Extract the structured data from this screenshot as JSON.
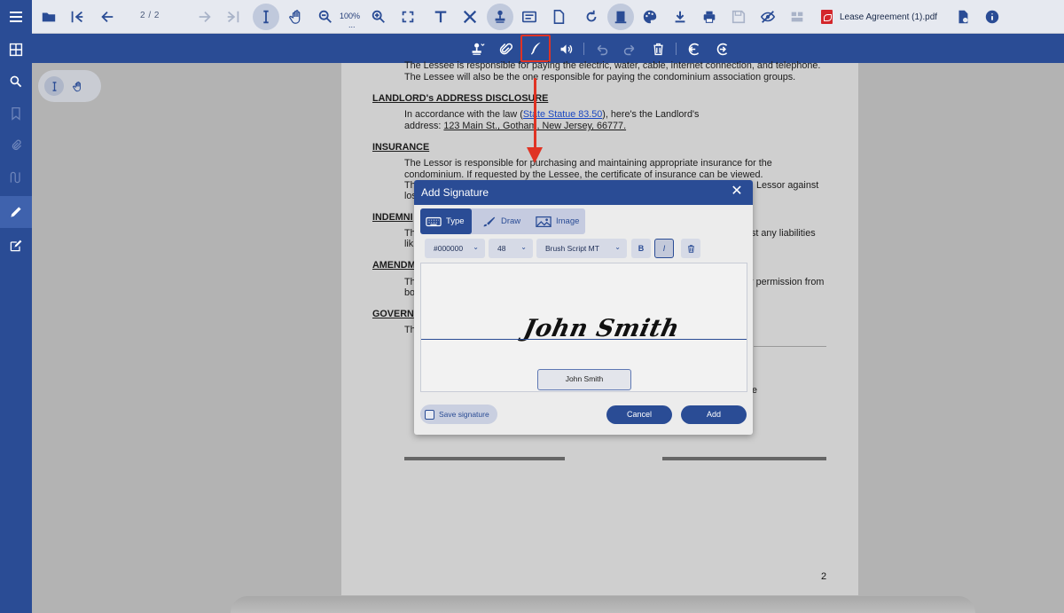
{
  "toolbar": {
    "page_indicator": "2 / 2",
    "zoom": "100%",
    "zoom_dots": "...",
    "filename": "Lease Agreement (1).pdf"
  },
  "document": {
    "line1": "The Lessee is responsible for paying the electric, water, cable, internet connection, and telephone.",
    "line2": "The Lessee will also be the one responsible for paying the condominium association groups.",
    "landlord_heading": "LANDLORD's ADDRESS DISCLOSURE",
    "landlord_text1_a": "In accordance with the law (",
    "landlord_link": "State Statue 83.50",
    "landlord_text1_b": "), here's the Landlord's",
    "landlord_text2_a": "address: ",
    "landlord_address": "123 Main St., Gotham, New Jersey, 66777.",
    "insurance_heading": "INSURANCE",
    "insurance_l1": "The Lessor is responsible for purchasing and maintaining appropriate insurance for the",
    "insurance_l2": "condominium. If requested by the Lessee, the certificate of insurance can be viewed.",
    "insurance_l3_a": "Th",
    "insurance_l3_b": "Lessor against",
    "insurance_l4": "los",
    "indemn_heading": "INDEMNI",
    "indemn_l1_a": "Th",
    "indemn_l1_b": "st any liabilities",
    "indemn_l2": "lik",
    "amend_heading": "AMENDM",
    "amend_l1_a": "Th",
    "amend_l1_b": "r permission from",
    "amend_l2": "bo",
    "gov_heading": "GOVERN",
    "gov_l1": "Th",
    "frag_e": "e",
    "page_number": "2"
  },
  "dialog": {
    "title": "Add Signature",
    "tabs": [
      {
        "label": "Type",
        "icon": "keyboard-icon"
      },
      {
        "label": "Draw",
        "icon": "brush-icon"
      },
      {
        "label": "Image",
        "icon": "image-icon"
      }
    ],
    "color": "#000000",
    "size": "48",
    "font": "Brush Script MT",
    "bold_label": "B",
    "italic_label": "I",
    "signature_preview": "John Smith",
    "name_value": "John Smith",
    "save_signature_label": "Save signature",
    "cancel_label": "Cancel",
    "add_label": "Add"
  },
  "colors": {
    "brand": "#2a4c95",
    "highlight": "#e03324"
  }
}
